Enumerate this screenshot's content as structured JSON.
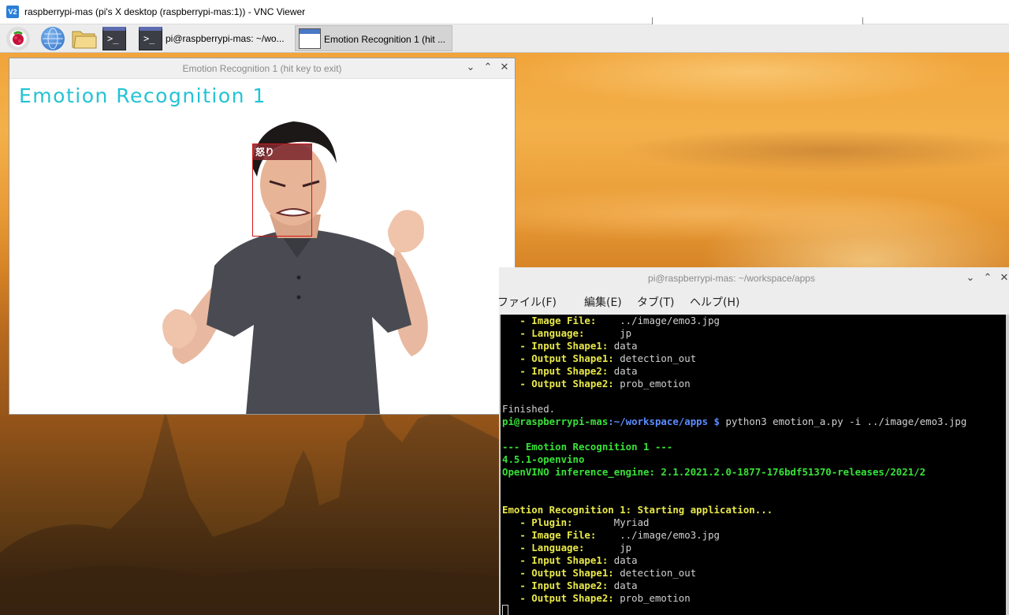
{
  "vnc": {
    "title": "raspberrypi-mas (pi's X desktop (raspberrypi-mas:1)) - VNC Viewer",
    "icon_text": "V2"
  },
  "taskbar": {
    "terminal_task_label": "pi@raspberrypi-mas: ~/wo...",
    "emotion_task_label": "Emotion Recognition 1  (hit ...",
    "term_glyph": ">_"
  },
  "emotion_window": {
    "title": "Emotion Recognition 1  (hit key to exit)",
    "heading": "Emotion Recognition 1",
    "face_label": "怒り",
    "controls": {
      "minimize": "⌄",
      "maximize": "⌃",
      "close": "✕"
    }
  },
  "terminal": {
    "title": "pi@raspberrypi-mas: ~/workspace/apps",
    "controls": {
      "minimize": "⌄",
      "maximize": "⌃",
      "close": "✕"
    },
    "menu": [
      "ファイル(F)",
      "編集(E)",
      "タブ(T)",
      "ヘルプ(H)"
    ],
    "prompt": {
      "user_host": "pi@raspberrypi-mas",
      "path": ":~/workspace/apps $",
      "command": " python3 emotion_a.py -i ../image/emo3.jpg"
    },
    "block1": [
      {
        "key": "   - Image File:",
        "value": "    ../image/emo3.jpg"
      },
      {
        "key": "   - Language:",
        "value": "      jp"
      },
      {
        "key": "   - Input Shape1:",
        "value": " data"
      },
      {
        "key": "   - Output Shape1:",
        "value": " detection_out"
      },
      {
        "key": "   - Input Shape2:",
        "value": " data"
      },
      {
        "key": "   - Output Shape2:",
        "value": " prob_emotion"
      }
    ],
    "finished": "Finished.",
    "header_line": "--- Emotion Recognition 1 ---",
    "version_line": "4.5.1-openvino",
    "engine_line": "OpenVINO inference_engine: 2.1.2021.2.0-1877-176bdf51370-releases/2021/2",
    "start_line": "Emotion Recognition 1: Starting application...",
    "block2": [
      {
        "key": "   - Plugin:",
        "value": "       Myriad"
      },
      {
        "key": "   - Image File:",
        "value": "    ../image/emo3.jpg"
      },
      {
        "key": "   - Language:",
        "value": "      jp"
      },
      {
        "key": "   - Input Shape1:",
        "value": " data"
      },
      {
        "key": "   - Output Shape1:",
        "value": " detection_out"
      },
      {
        "key": "   - Input Shape2:",
        "value": " data"
      },
      {
        "key": "   - Output Shape2:",
        "value": " prob_emotion"
      }
    ]
  }
}
